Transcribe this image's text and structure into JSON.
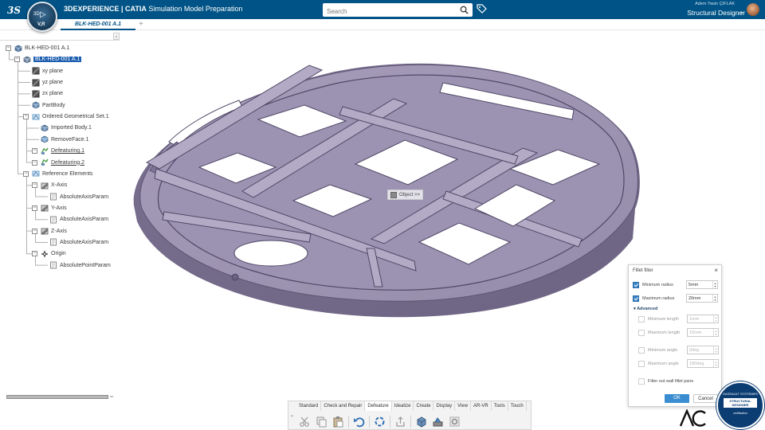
{
  "app": {
    "brand": "3DEXPERIENCE | CATIA",
    "app_name": "Simulation Model Preparation",
    "compass_label": "3D",
    "compass_version": "V,R",
    "user_name": "Adem Yasin ÇIFLAK",
    "role": "Structural Designer"
  },
  "search": {
    "placeholder": "Search",
    "value": ""
  },
  "tabs": {
    "active": "BLK-HED-001 A.1",
    "add": "+"
  },
  "tree": {
    "collapse_icon": "‹",
    "nodes": [
      {
        "label": "BLK-HED-001 A.1",
        "icon": "product-icon"
      },
      {
        "label": "BLK-HED-001 A.1",
        "icon": "part-icon",
        "selected": true
      },
      {
        "label": "xy plane",
        "icon": "plane-icon"
      },
      {
        "label": "yz plane",
        "icon": "plane-icon"
      },
      {
        "label": "zx plane",
        "icon": "plane-icon"
      },
      {
        "label": "PartBody",
        "icon": "body-icon"
      },
      {
        "label": "Ordered Geometrical Set.1",
        "icon": "geoset-icon"
      },
      {
        "label": "Imported Body.1",
        "icon": "imported-body-icon"
      },
      {
        "label": "RemoveFace.1",
        "icon": "remove-face-icon"
      },
      {
        "label": "Defeaturing.1",
        "icon": "defeaturing-icon"
      },
      {
        "label": "Defeaturing.2",
        "icon": "defeaturing-icon"
      },
      {
        "label": "Reference Elements",
        "icon": "geoset-icon"
      },
      {
        "label": "X-Axis",
        "icon": "axis-icon"
      },
      {
        "label": "AbsoluteAxisParam",
        "icon": "param-icon"
      },
      {
        "label": "Y-Axis",
        "icon": "axis-icon"
      },
      {
        "label": "AbsoluteAxisParam",
        "icon": "param-icon"
      },
      {
        "label": "Z-Axis",
        "icon": "axis-icon"
      },
      {
        "label": "AbsoluteAxisParam",
        "icon": "param-icon"
      },
      {
        "label": "Origin",
        "icon": "origin-icon"
      },
      {
        "label": "AbsolutePointParam",
        "icon": "param-icon"
      }
    ]
  },
  "viewport": {
    "context_label": "Object >>"
  },
  "fillet_filter": {
    "title": "Fillet filter",
    "close": "×",
    "minimum_radius": {
      "label": "Minimum radius",
      "value": "5mm",
      "checked": true
    },
    "maximum_radius": {
      "label": "Maximum radius",
      "value": "20mm",
      "checked": true
    },
    "advanced": "▾ Advanced",
    "minimum_length": {
      "label": "Minimum length",
      "value": "1mm",
      "checked": false
    },
    "maximum_length": {
      "label": "Maximum length",
      "value": "10mm",
      "checked": false
    },
    "minimum_angle": {
      "label": "Minimum angle",
      "value": "0deg",
      "checked": false
    },
    "maximum_angle": {
      "label": "Maximum angle",
      "value": "180deg",
      "checked": false
    },
    "filter_wall": {
      "label": "Filter out wall fillet pairs",
      "checked": false
    },
    "ok": "OK",
    "cancel": "Cancel"
  },
  "action_bar": {
    "toggle": "⌄",
    "tabs": [
      "Standard",
      "Check and Repair",
      "Defeature",
      "Idealize",
      "Create",
      "Display",
      "View",
      "AR-VR",
      "Tools",
      "Touch"
    ],
    "active_tab": "Defeature",
    "tools": [
      "cut-icon",
      "copy-icon",
      "paste-icon",
      "undo-icon",
      "update-icon",
      "share-icon",
      "tool-a-icon",
      "tool-b-icon",
      "tool-c-icon"
    ]
  },
  "logos": {
    "ac": "AC",
    "badge_top": "DASSAULT SYSTEMES",
    "badge_mid": "STRUCTURAL DESIGNER",
    "badge_bottom": "certification"
  },
  "colors": {
    "topbar": "#005386",
    "accent": "#3a8dd0",
    "model": "#938aa6",
    "selection": "#1f5fb0"
  }
}
